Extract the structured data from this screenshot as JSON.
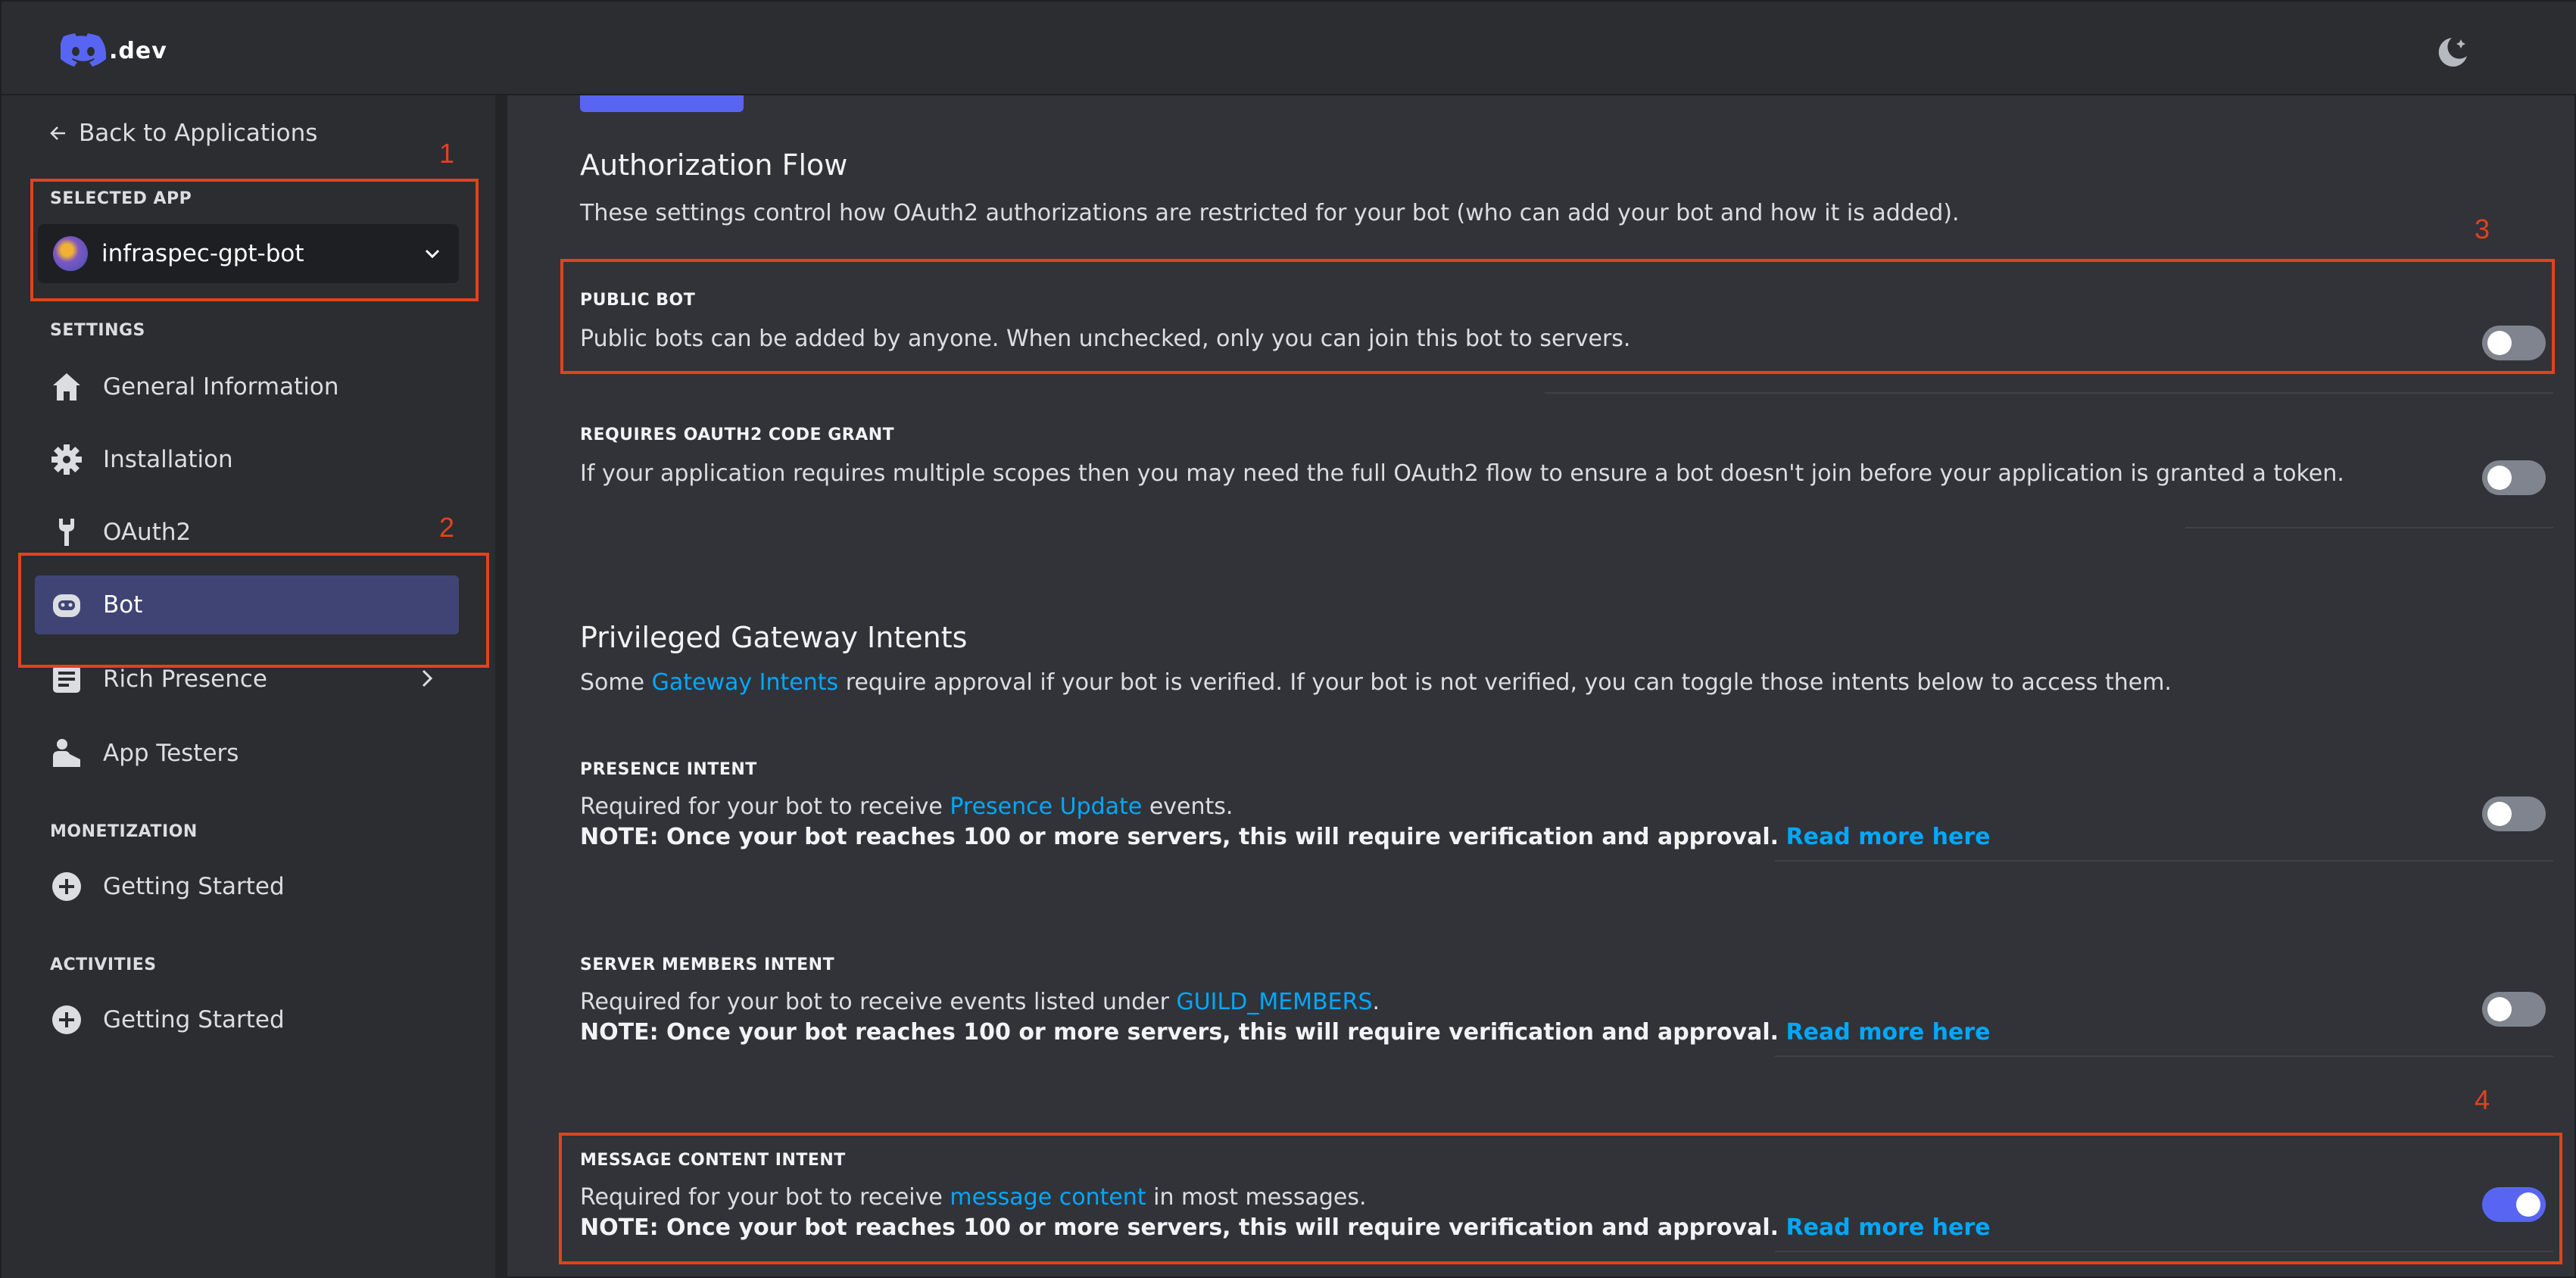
{
  "header": {
    "logo_text": ".dev",
    "theme_icon": "moon-star-icon"
  },
  "sidebar": {
    "back_label": "Back to Applications",
    "selected_app_label": "SELECTED APP",
    "app_name": "infraspec-gpt-bot",
    "settings_label": "SETTINGS",
    "items": [
      {
        "label": "General Information",
        "icon": "home-icon"
      },
      {
        "label": "Installation",
        "icon": "gear-icon"
      },
      {
        "label": "OAuth2",
        "icon": "wrench-icon"
      },
      {
        "label": "Bot",
        "icon": "bot-icon",
        "active": true
      },
      {
        "label": "Rich Presence",
        "icon": "list-icon"
      },
      {
        "label": "App Testers",
        "icon": "user-tester-icon"
      }
    ],
    "monetization_label": "MONETIZATION",
    "monetization_item": "Getting Started",
    "activities_label": "ACTIVITIES",
    "activities_item": "Getting Started"
  },
  "annotations": [
    "1",
    "2",
    "3",
    "4"
  ],
  "main": {
    "auth_flow": {
      "title": "Authorization Flow",
      "description": "These settings control how OAuth2 authorizations are restricted for your bot (who can add your bot and how it is added).",
      "public_bot": {
        "title": "PUBLIC BOT",
        "text": "Public bots can be added by anyone. When unchecked, only you can join this bot to servers.",
        "enabled": false
      },
      "code_grant": {
        "title": "REQUIRES OAUTH2 CODE GRANT",
        "text": "If your application requires multiple scopes then you may need the full OAuth2 flow to ensure a bot doesn't join before your application is granted a token.",
        "enabled": false
      }
    },
    "intents": {
      "title": "Privileged Gateway Intents",
      "desc_before": "Some ",
      "desc_link": "Gateway Intents",
      "desc_after": " require approval if your bot is verified. If your bot is not verified, you can toggle those intents below to access them.",
      "note": "NOTE: Once your bot reaches 100 or more servers, this will require verification and approval.",
      "read_more": "Read more here",
      "presence": {
        "title": "PRESENCE INTENT",
        "before": "Required for your bot to receive ",
        "link": "Presence Update",
        "after": " events.",
        "enabled": false
      },
      "members": {
        "title": "SERVER MEMBERS INTENT",
        "before": "Required for your bot to receive events listed under ",
        "link": "GUILD_MEMBERS",
        "after": ".",
        "enabled": false
      },
      "message_content": {
        "title": "MESSAGE CONTENT INTENT",
        "before": "Required for your bot to receive ",
        "link": "message content",
        "after": " in most messages.",
        "enabled": true
      }
    }
  },
  "colors": {
    "accent": "#5865f2",
    "link": "#00a8fc",
    "annotation": "#e0431d"
  }
}
